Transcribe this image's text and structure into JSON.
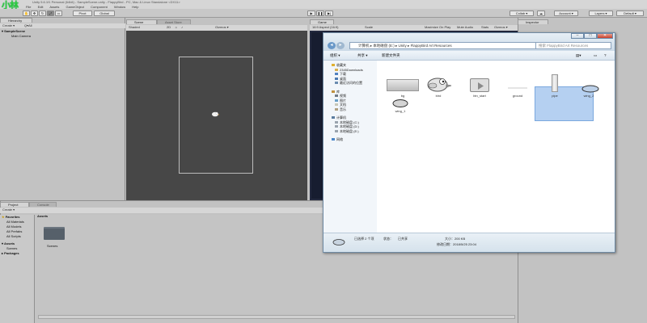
{
  "logo_text": "小林",
  "titlebar": "Unity 5.6.1f1 Personal (64bit) - SampleScene.unity - FlappyBird - PC, Mac & Linux Standalone <DX11>",
  "menu": [
    "File",
    "Edit",
    "Assets",
    "GameObject",
    "Component",
    "Window",
    "Help"
  ],
  "toolbar": {
    "pivot": "Pivot",
    "global": "Global",
    "collab": "Collab ▾",
    "account": "Account ▾",
    "layers": "Layers ▾",
    "layout": "Default ▾"
  },
  "hierarchy": {
    "tab": "Hierarchy",
    "create": "Create ▾",
    "search": "Q▾All",
    "scene": "SampleScene",
    "items": [
      "Main Camera"
    ]
  },
  "scene": {
    "tabs": [
      "Scene",
      "Asset Store"
    ],
    "shaded": "Shaded",
    "mode_2d": "2D",
    "gizmos": "Gizmos ▾"
  },
  "game": {
    "tab": "Game",
    "aspect": "16:9 Aspect (16:9)",
    "scale": "Scale",
    "options": [
      "Maximize On Play",
      "Mute Audio",
      "Stats",
      "Gizmos ▾"
    ]
  },
  "inspector": {
    "tab": "Inspector"
  },
  "project": {
    "tabs": [
      "Project",
      "Console"
    ],
    "create": "Create ▾",
    "favorites": "Favorites",
    "favorites_items": [
      "All Materials",
      "All Models",
      "All Prefabs",
      "All Scripts"
    ],
    "assets_root": "Assets",
    "assets_children": [
      "Scenes"
    ],
    "packages": "Packages",
    "breadcrumb": "Assets",
    "folder_label": "Scenes"
  },
  "explorer": {
    "breadcrumb": [
      "计算机",
      "本地磁盘 (E:)",
      "Unity",
      "FlappyBird Art Resources"
    ],
    "search_placeholder": "搜索 FlappyBird Art Resources",
    "commands": [
      "组织 ▾",
      "共享 ▾",
      "新建文件夹"
    ],
    "nav": {
      "favorites_title": "收藏夹",
      "favorites": [
        "2345Downloads",
        "下载",
        "桌面",
        "最近访问的位置"
      ],
      "library_title": "库",
      "libraries": [
        "视频",
        "图片",
        "文档",
        "音乐"
      ],
      "computer_title": "计算机",
      "drives": [
        "本地磁盘 (C:)",
        "本地磁盘 (D:)",
        "本地磁盘 (E:)"
      ],
      "network": "网络"
    },
    "files": [
      {
        "name": "bg",
        "kind": "background"
      },
      {
        "name": "bird",
        "kind": "bird"
      },
      {
        "name": "btn_start",
        "kind": "button"
      },
      {
        "name": "ground",
        "kind": "ground"
      },
      {
        "name": "pipe",
        "kind": "pipe"
      },
      {
        "name": "wing_1",
        "kind": "wing"
      },
      {
        "name": "wing_2",
        "kind": "wing"
      }
    ],
    "status": {
      "summary": "已选择 2 个项",
      "state_label": "状态：",
      "state_value": "已共享",
      "size": "大小：200 KB",
      "modified": "修改日期：2018/5/25 23:04"
    },
    "window_buttons": [
      "–",
      "□",
      "✕"
    ]
  },
  "colors": {
    "scene_bg": "#474747",
    "game_bg": "#171d30",
    "selection": "#3d6ec2",
    "explorer_frame": "#d7e3ec",
    "logo": "#2ecc40"
  }
}
